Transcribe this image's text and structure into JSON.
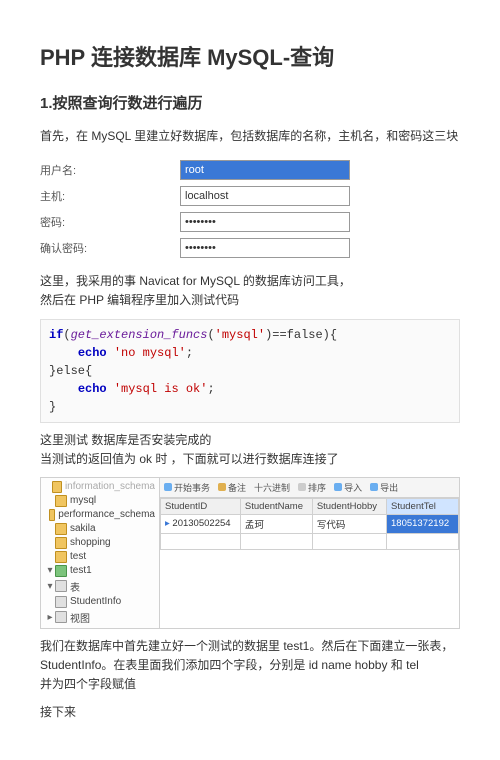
{
  "title": "PHP 连接数据库 MySQL-查询",
  "section1": "1.按照查询行数进行遍历",
  "intro": "首先，在 MySQL 里建立好数据库，包括数据库的名称，主机名，和密码这三块",
  "form": {
    "username_label": "用户名:",
    "username_value": "root",
    "host_label": "主机:",
    "host_value": "localhost",
    "password_label": "密码:",
    "password_value": "••••••••",
    "confirm_label": "确认密码:",
    "confirm_value": "••••••••"
  },
  "para2a": "这里，我采用的事 Navicat for MySQL 的数据库访问工具，",
  "para2b": "然后在 PHP 编辑程序里加入测试代码",
  "code": {
    "l1a": "if",
    "l1b": "(",
    "l1c": "get_extension_funcs",
    "l1d": "(",
    "l1e": "'mysql'",
    "l1f": ")==false){",
    "l2a": "    ",
    "l2b": "echo",
    "l2c": " ",
    "l2d": "'no mysql'",
    "l2e": ";",
    "l3": "}else{",
    "l4a": "    ",
    "l4b": "echo",
    "l4c": " ",
    "l4d": "'mysql is ok'",
    "l4e": ";",
    "l5": "}"
  },
  "para3a": "这里测试 数据库是否安装完成的",
  "para3b": "当测试的返回值为 ok 时 ，下面就可以进行数据库连接了",
  "nav": {
    "tree": {
      "t0": "information_schema",
      "t1": "mysql",
      "t2": "performance_schema",
      "t3": "sakila",
      "t4": "shopping",
      "t5": "test",
      "t6": "test1",
      "t7": "表",
      "t8": "StudentInfo",
      "t9": "视图"
    },
    "toolbar": {
      "b1": "开始事务",
      "b2": "备注",
      "b3": "十六进制",
      "b4": "排序",
      "b5": "导入",
      "b6": "导出"
    },
    "table": {
      "h1": "StudentID",
      "h2": "StudentName",
      "h3": "StudentHobby",
      "h4": "StudentTel",
      "r1c1": "20130502254",
      "r1c2": "孟珂",
      "r1c3": "写代码",
      "r1c4": "18051372192"
    }
  },
  "para4a": "我们在数据库中首先建立好一个测试的数据里 test1。然后在下面建立一张表，",
  "para4b": "StudentInfo。在表里面我们添加四个字段，分别是 id name hobby  和 tel",
  "para4c": "并为四个字段赋值",
  "para5": "接下来"
}
